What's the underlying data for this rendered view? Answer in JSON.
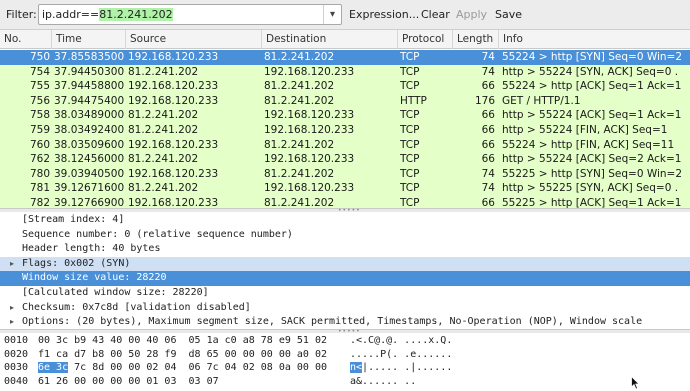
{
  "toolbar": {
    "filter_label": "Filter:",
    "filter_prefix": "ip.addr==",
    "filter_value": "81.2.241.202",
    "dropdown_glyph": "▾",
    "buttons": [
      "Expression...",
      "Clear",
      "Apply",
      "Save"
    ]
  },
  "columns": [
    "No.",
    "Time",
    "Source",
    "Destination",
    "Protocol",
    "Length",
    "Info"
  ],
  "packets": [
    {
      "no": "750",
      "time": "37.85583500",
      "src": "192.168.120.233",
      "dst": "81.2.241.202",
      "proto": "TCP",
      "len": "74",
      "info": "55224 > http [SYN] Seq=0 Win=2",
      "selected": true
    },
    {
      "no": "754",
      "time": "37.94450300",
      "src": "81.2.241.202",
      "dst": "192.168.120.233",
      "proto": "TCP",
      "len": "74",
      "info": "http > 55224 [SYN, ACK] Seq=0 ."
    },
    {
      "no": "755",
      "time": "37.94458800",
      "src": "192.168.120.233",
      "dst": "81.2.241.202",
      "proto": "TCP",
      "len": "66",
      "info": "55224 > http [ACK] Seq=1 Ack=1"
    },
    {
      "no": "756",
      "time": "37.94475400",
      "src": "192.168.120.233",
      "dst": "81.2.241.202",
      "proto": "HTTP",
      "len": "176",
      "info": "GET / HTTP/1.1"
    },
    {
      "no": "758",
      "time": "38.03489000",
      "src": "81.2.241.202",
      "dst": "192.168.120.233",
      "proto": "TCP",
      "len": "66",
      "info": "http > 55224 [ACK] Seq=1 Ack=1"
    },
    {
      "no": "759",
      "time": "38.03492400",
      "src": "81.2.241.202",
      "dst": "192.168.120.233",
      "proto": "TCP",
      "len": "66",
      "info": "http > 55224 [FIN, ACK] Seq=1"
    },
    {
      "no": "760",
      "time": "38.03509600",
      "src": "192.168.120.233",
      "dst": "81.2.241.202",
      "proto": "TCP",
      "len": "66",
      "info": "55224 > http [FIN, ACK] Seq=11"
    },
    {
      "no": "762",
      "time": "38.12456000",
      "src": "81.2.241.202",
      "dst": "192.168.120.233",
      "proto": "TCP",
      "len": "66",
      "info": "http > 55224 [ACK] Seq=2 Ack=1"
    },
    {
      "no": "780",
      "time": "39.03940500",
      "src": "192.168.120.233",
      "dst": "81.2.241.202",
      "proto": "TCP",
      "len": "74",
      "info": "55225 > http [SYN] Seq=0 Win=2"
    },
    {
      "no": "781",
      "time": "39.12671600",
      "src": "81.2.241.202",
      "dst": "192.168.120.233",
      "proto": "TCP",
      "len": "74",
      "info": "http > 55225 [SYN, ACK] Seq=0 ."
    },
    {
      "no": "782",
      "time": "39.12766900",
      "src": "192.168.120.233",
      "dst": "81.2.241.202",
      "proto": "TCP",
      "len": "66",
      "info": "55225 > http [ACK] Seq=1 Ack=1"
    }
  ],
  "details": [
    {
      "text": "[Stream index: 4]",
      "arrow": ""
    },
    {
      "text": "Sequence number: 0    (relative sequence number)",
      "arrow": ""
    },
    {
      "text": "Header length: 40 bytes",
      "arrow": ""
    },
    {
      "text": "Flags: 0x002 (SYN)",
      "arrow": "▸",
      "style": "flag"
    },
    {
      "text": "Window size value: 28220",
      "arrow": "",
      "style": "sel"
    },
    {
      "text": "[Calculated window size: 28220]",
      "arrow": ""
    },
    {
      "text": "Checksum: 0x7c8d [validation disabled]",
      "arrow": "▸"
    },
    {
      "text": "Options: (20 bytes), Maximum segment size, SACK permitted, Timestamps, No-Operation (NOP), Window scale",
      "arrow": "▸"
    }
  ],
  "bytes": [
    {
      "off": "0010",
      "hex": "00 3c b9 43 40 00 40 06  05 1a c0 a8 78 e9 51 02",
      "asc": ".<.C@.@. ....x.Q."
    },
    {
      "off": "0020",
      "hex": "f1 ca d7 b8 00 50 28 f9  d8 65 00 00 00 00 a0 02",
      "asc": ".....P(. .e......"
    },
    {
      "off": "0030",
      "hex_sel": "6e 3c",
      "hex": " 7c 8d 00 00 02 04  06 7c 04 02 08 0a 00 00",
      "asc_sel": "n<",
      "asc": "|..... .|......"
    },
    {
      "off": "0040",
      "hex": "61 26 00 00 00 00 01 03  03 07",
      "asc": "a&...... .."
    }
  ]
}
